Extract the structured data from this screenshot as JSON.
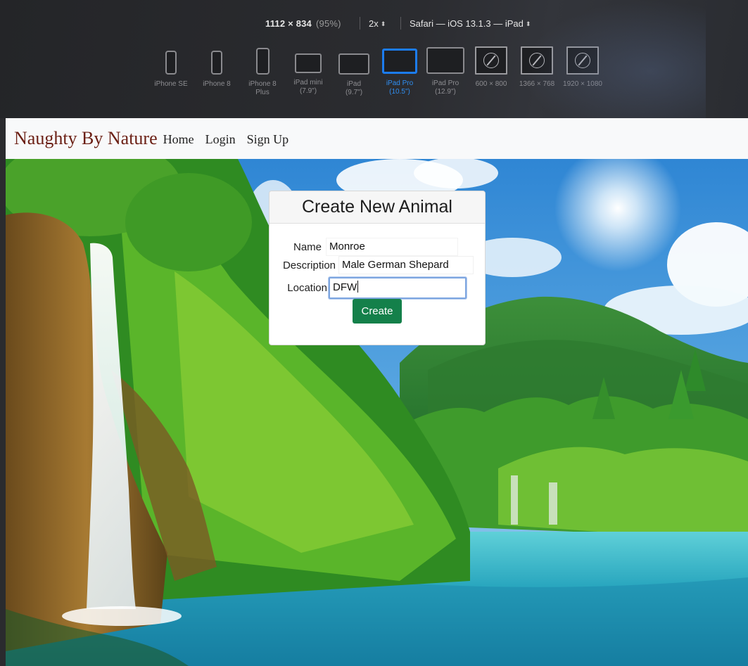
{
  "toolbar": {
    "dimensions": "1112 × 834",
    "zoom": "(95%)",
    "scale": "2x",
    "browser": "Safari — iOS 13.1.3 — iPad",
    "devices": [
      {
        "name": "iPhone SE",
        "line2": ""
      },
      {
        "name": "iPhone 8",
        "line2": ""
      },
      {
        "name": "iPhone 8",
        "line2": "Plus"
      },
      {
        "name": "iPad mini",
        "line2": "(7.9\")"
      },
      {
        "name": "iPad",
        "line2": "(9.7\")"
      },
      {
        "name": "iPad Pro",
        "line2": "(10.5\")"
      },
      {
        "name": "iPad Pro",
        "line2": "(12.9\")"
      },
      {
        "name": "600 × 800",
        "line2": ""
      },
      {
        "name": "1366 × 768",
        "line2": ""
      },
      {
        "name": "1920 × 1080",
        "line2": ""
      }
    ],
    "selected_device": "iPad Pro (10.5\")"
  },
  "navbar": {
    "brand": "Naughty By Nature",
    "links": [
      "Home",
      "Login",
      "Sign Up"
    ]
  },
  "form": {
    "title": "Create New Animal",
    "name_label": "Name",
    "name_value": "Monroe",
    "description_label": "Description",
    "description_value": "Male German Shepard",
    "location_label": "Location",
    "location_value": "DFW",
    "submit_label": "Create"
  },
  "colors": {
    "brand": "#6b1f14",
    "button": "#14804a",
    "selected_device": "#1c7cf0",
    "focus_ring": "#7ea6e0"
  }
}
